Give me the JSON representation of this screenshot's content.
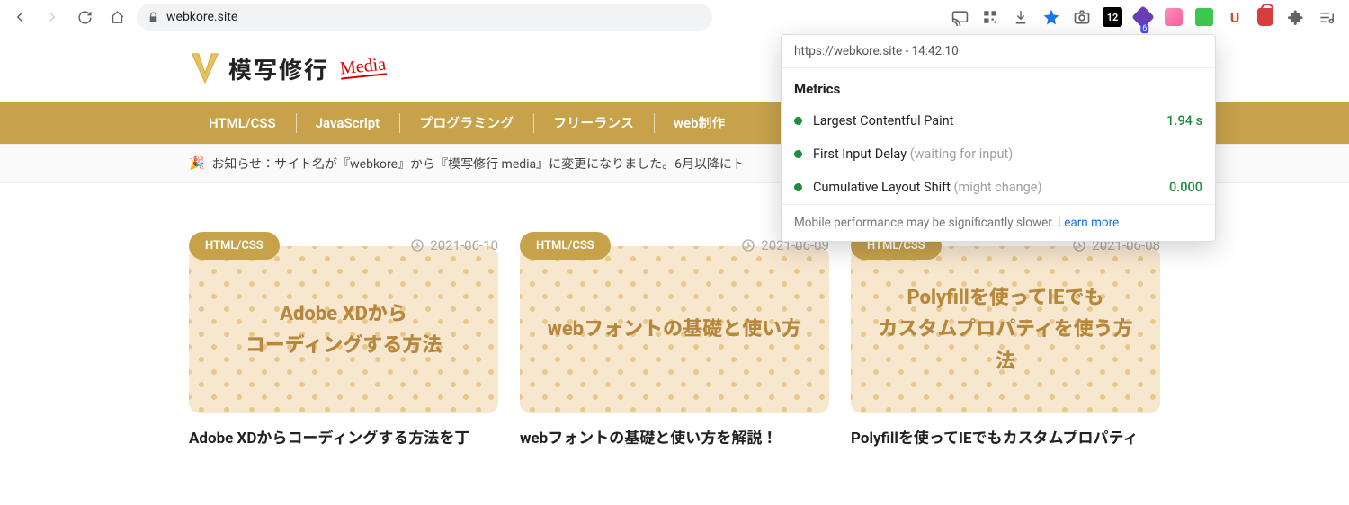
{
  "browser": {
    "url": "webkore.site",
    "extensions": {
      "badge_calendar": "12",
      "badge_purple": "6",
      "letter_u": "U"
    }
  },
  "popup": {
    "origin_time": "https://webkore.site - 14:42:10",
    "title": "Metrics",
    "metrics": [
      {
        "label": "Largest Contentful Paint",
        "hint": "",
        "value": "1.94 s",
        "status": "good"
      },
      {
        "label": "First Input Delay",
        "hint": "(waiting for input)",
        "value": "",
        "status": "good"
      },
      {
        "label": "Cumulative Layout Shift",
        "hint": "(might change)",
        "value": "0.000",
        "status": "good"
      }
    ],
    "footer_text": "Mobile performance may be significantly slower. ",
    "footer_link": "Learn more"
  },
  "site": {
    "logo_text": "模写修行",
    "logo_media": "Media"
  },
  "nav": {
    "items": [
      "HTML/CSS",
      "JavaScript",
      "プログラミング",
      "フリーランス",
      "web制作"
    ]
  },
  "notice": {
    "emoji": "🎉",
    "text": "お知らせ：サイト名が『webkore』から『模写修行 media』に変更になりました。6月以降にト"
  },
  "cards": [
    {
      "tag": "HTML/CSS",
      "date": "2021-06-10",
      "tile_title": "Adobe XDから\nコーディングする方法",
      "caption": "Adobe XDからコーディングする方法を丁"
    },
    {
      "tag": "HTML/CSS",
      "date": "2021-06-09",
      "tile_title": "webフォントの基礎と使い方",
      "caption": "webフォントの基礎と使い方を解説！"
    },
    {
      "tag": "HTML/CSS",
      "date": "2021-06-08",
      "tile_title": "Polyfillを使ってIEでも\nカスタムプロパティを使う方法",
      "caption": "Polyfillを使ってIEでもカスタムプロパティ"
    }
  ]
}
